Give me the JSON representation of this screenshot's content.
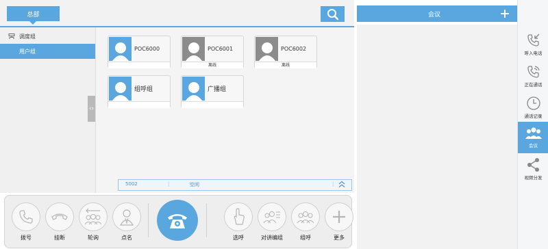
{
  "header": {
    "tab_label": "总部"
  },
  "tree": {
    "dispatch_group": "调度组",
    "user_group": "用户组"
  },
  "cards": [
    {
      "name": "POC6000",
      "status": "",
      "avatar_color": "#5aa7df"
    },
    {
      "name": "POC6001",
      "status": "离线",
      "avatar_color": "#8c8c8c"
    },
    {
      "name": "POC6002",
      "status": "离线",
      "avatar_color": "#8c8c8c"
    },
    {
      "name": "组呼组",
      "status": "",
      "avatar_color": "#5aa7df"
    },
    {
      "name": "广播组",
      "status": "",
      "avatar_color": "#5aa7df"
    }
  ],
  "statusbar": {
    "number": "5002",
    "state": "空闲"
  },
  "conference": {
    "title": "会议"
  },
  "sidebar": {
    "items": [
      {
        "label": "呼入电话",
        "icon": "incoming-call-icon"
      },
      {
        "label": "正在通话",
        "icon": "active-call-icon"
      },
      {
        "label": "通话记录",
        "icon": "call-history-icon"
      },
      {
        "label": "会议",
        "icon": "conference-icon"
      },
      {
        "label": "视频分发",
        "icon": "video-share-icon"
      }
    ],
    "active_index": 3
  },
  "toolbar": {
    "dial": "拨号",
    "hangup": "挂断",
    "poll": "轮询",
    "rollcall": "点名",
    "select_call": "选呼",
    "intercom_edit": "对讲编组",
    "group_call": "组呼",
    "more": "更多"
  },
  "colors": {
    "accent": "#5aa7df",
    "offline": "#8c8c8c",
    "panel": "#f2f2f2"
  }
}
